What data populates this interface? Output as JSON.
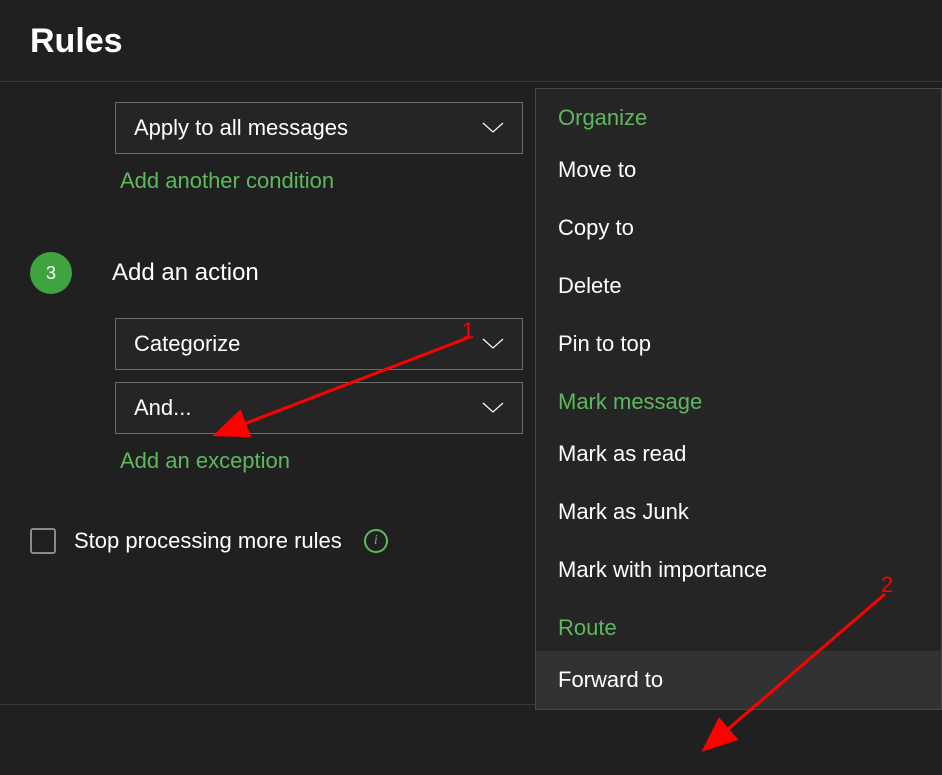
{
  "header": {
    "title": "Rules"
  },
  "condition_section": {
    "dropdown_label": "Apply to all messages",
    "add_link": "Add another condition"
  },
  "action_section": {
    "step_number": "3",
    "title": "Add an action",
    "dropdowns": [
      {
        "label": "Categorize"
      },
      {
        "label": "And..."
      }
    ],
    "exception_link": "Add an exception"
  },
  "stop_processing": {
    "label": "Stop processing more rules"
  },
  "action_menu": {
    "groups": [
      {
        "header": "Organize",
        "items": [
          {
            "label": "Move to",
            "highlighted": false
          },
          {
            "label": "Copy to",
            "highlighted": false
          },
          {
            "label": "Delete",
            "highlighted": false
          },
          {
            "label": "Pin to top",
            "highlighted": false
          }
        ]
      },
      {
        "header": "Mark message",
        "items": [
          {
            "label": "Mark as read",
            "highlighted": false
          },
          {
            "label": "Mark as Junk",
            "highlighted": false
          },
          {
            "label": "Mark with importance",
            "highlighted": false
          }
        ]
      },
      {
        "header": "Route",
        "items": [
          {
            "label": "Forward to",
            "highlighted": true
          }
        ]
      }
    ]
  },
  "annotations": {
    "label1": "1",
    "label2": "2"
  }
}
